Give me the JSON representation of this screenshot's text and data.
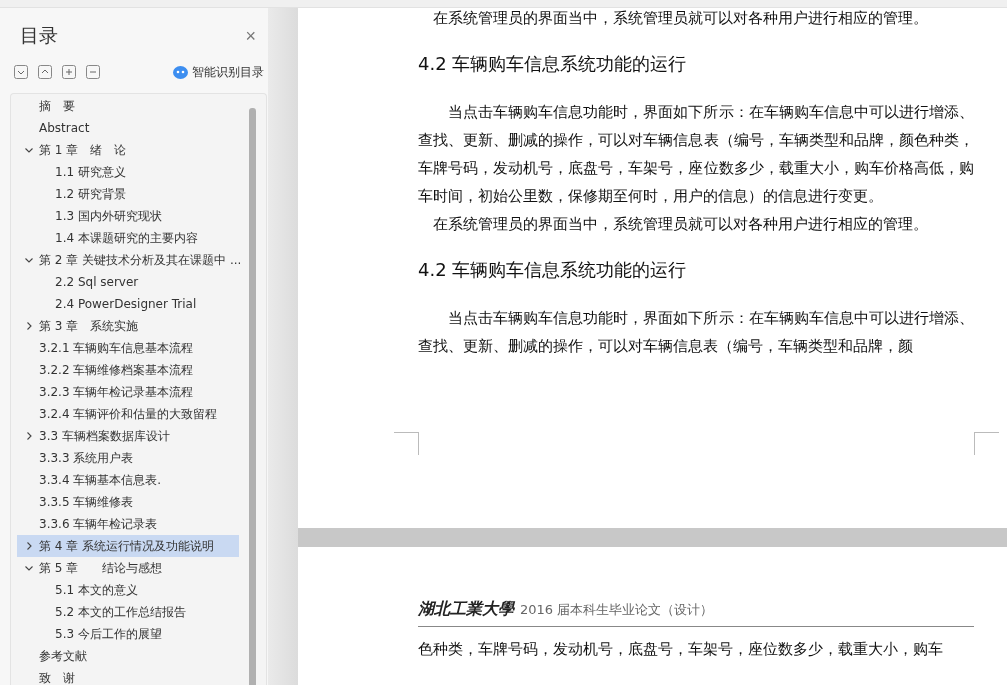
{
  "sidebar": {
    "title": "目录",
    "close": "×",
    "smart_button": "智能识别目录",
    "toc": [
      {
        "label": "摘　要",
        "selected": false
      },
      {
        "label": "Abstract",
        "selected": false
      },
      {
        "label": "第 1 章　绪　论",
        "selected": false,
        "expanded": true,
        "children": [
          {
            "label": "1.1 研究意义",
            "selected": false
          },
          {
            "label": "1.2 研究背景",
            "selected": false
          },
          {
            "label": "1.3 国内外研究现状",
            "selected": false
          },
          {
            "label": "1.4 本课题研究的主要内容",
            "selected": false
          }
        ]
      },
      {
        "label": "第 2 章  关键技术分析及其在课题中 ...",
        "selected": false,
        "expanded": true,
        "children": [
          {
            "label": "2.2 Sql server",
            "selected": false
          },
          {
            "label": "2.4 PowerDesigner Trial",
            "selected": false
          }
        ]
      },
      {
        "label": "第 3 章　系统实施",
        "selected": false,
        "expanded": false
      },
      {
        "label": "3.2.1 车辆购车信息基本流程",
        "selected": false
      },
      {
        "label": "3.2.2 车辆维修档案基本流程",
        "selected": false
      },
      {
        "label": "3.2.3 车辆年检记录基本流程",
        "selected": false
      },
      {
        "label": "3.2.4 车辆评价和估量的大致留程",
        "selected": false
      },
      {
        "label": "3.3 车辆档案数据库设计",
        "selected": false,
        "expanded": false
      },
      {
        "label": "3.3.3 系统用户表",
        "selected": false
      },
      {
        "label": "3.3.4 车辆基本信息表.",
        "selected": false
      },
      {
        "label": "3.3.5 车辆维修表",
        "selected": false
      },
      {
        "label": "3.3.6 车辆年检记录表",
        "selected": false
      },
      {
        "label": "第 4 章  系统运行情况及功能说明",
        "selected": true,
        "expanded": false
      },
      {
        "label": "第 5 章　　结论与感想",
        "selected": false,
        "expanded": true,
        "children": [
          {
            "label": "5.1 本文的意义",
            "selected": false
          },
          {
            "label": "5.2 本文的工作总结报告",
            "selected": false
          },
          {
            "label": "5.3 今后工作的展望",
            "selected": false
          }
        ]
      },
      {
        "label": "参考文献",
        "selected": false
      },
      {
        "label": "致　谢",
        "selected": false
      }
    ]
  },
  "pages": [
    {
      "blocks": [
        {
          "kind": "line",
          "text": "在系统管理员的界面当中，系统管理员就可以对各种用户进行相应的管理。"
        },
        {
          "kind": "heading",
          "text": "4.2  车辆购车信息系统功能的运行"
        },
        {
          "kind": "body",
          "text": "当点击车辆购车信息功能时，界面如下所示：在车辆购车信息中可以进行增添、查找、更新、删减的操作，可以对车辆信息表（编号，车辆类型和品牌，颜色种类，车牌号码，发动机号，底盘号，车架号，座位数多少，载重大小，购车价格高低，购车时间，初始公里数，保修期至何时，用户的信息）的信息进行变更。"
        },
        {
          "kind": "line",
          "text": "在系统管理员的界面当中，系统管理员就可以对各种用户进行相应的管理。"
        },
        {
          "kind": "heading",
          "text": "4.2  车辆购车信息系统功能的运行"
        },
        {
          "kind": "body",
          "text": "当点击车辆购车信息功能时，界面如下所示：在车辆购车信息中可以进行增添、查找、更新、删减的操作，可以对车辆信息表（编号，车辆类型和品牌，颜"
        }
      ]
    },
    {
      "header": {
        "logo": "湖北工業大學",
        "title": "2016 届本科生毕业论文（设计）"
      },
      "blocks": [
        {
          "kind": "cont",
          "text": "色种类，车牌号码，发动机号，底盘号，车架号，座位数多少，载重大小，购车"
        }
      ]
    }
  ]
}
